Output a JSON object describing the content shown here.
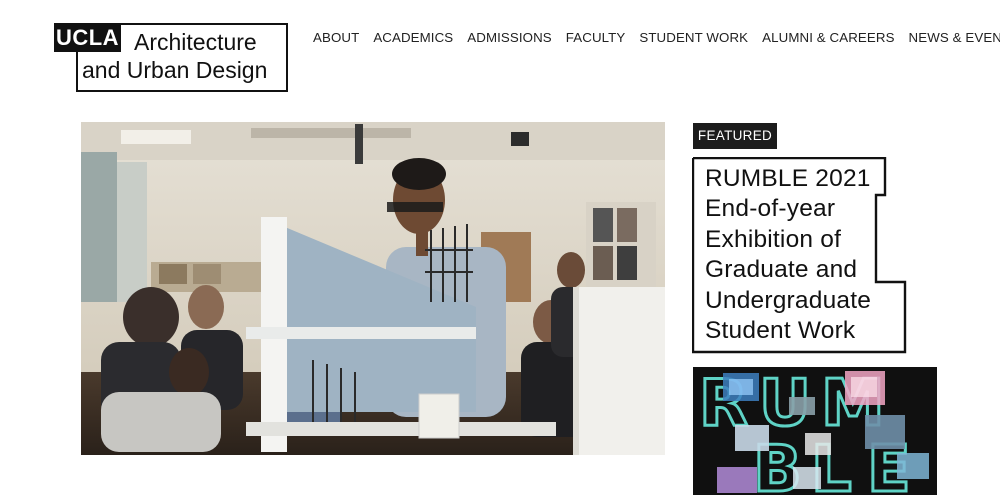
{
  "logo": {
    "badge": "UCLA",
    "line1": "Architecture",
    "line2": "and Urban Design"
  },
  "nav": {
    "items": [
      {
        "label": "ABOUT"
      },
      {
        "label": "ACADEMICS"
      },
      {
        "label": "ADMISSIONS"
      },
      {
        "label": "FACULTY"
      },
      {
        "label": "STUDENT WORK"
      },
      {
        "label": "ALUMNI & CAREERS"
      },
      {
        "label": "NEWS & EVENTS"
      }
    ]
  },
  "featured": {
    "tag": "FEATURED",
    "title_lines": [
      "RUMBLE 2021",
      "End-of-year",
      "Exhibition of",
      "Graduate and",
      "Undergraduate",
      "Student Work"
    ],
    "poster_letters": [
      "R",
      "U",
      "M",
      "B",
      "L",
      "E"
    ]
  },
  "colors": {
    "text": "#111111",
    "background": "#ffffff",
    "tag_bg": "#1c1c1c",
    "poster_bg": "#101010",
    "poster_letters": "#5fd3c6"
  }
}
